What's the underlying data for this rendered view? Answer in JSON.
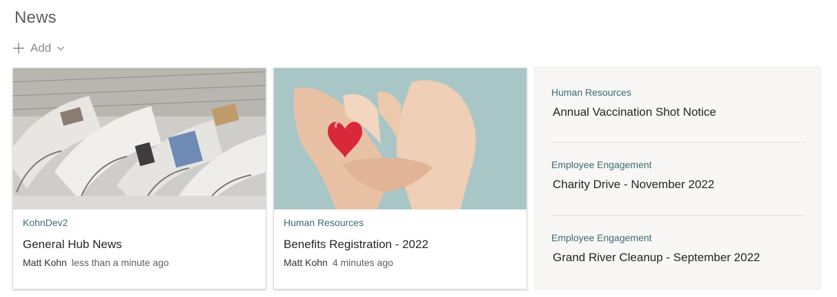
{
  "section": {
    "title": "News"
  },
  "toolbar": {
    "add_label": "Add"
  },
  "cards": [
    {
      "site": "KohnDev2",
      "title": "General Hub News",
      "author": "Matt Kohn",
      "time": "less than a minute ago",
      "image": "newspapers"
    },
    {
      "site": "Human Resources",
      "title": "Benefits Registration - 2022",
      "author": "Matt Kohn",
      "time": "4 minutes ago",
      "image": "hands-holding-heart"
    }
  ],
  "side_list": [
    {
      "site": "Human Resources",
      "title": "Annual Vaccination Shot Notice"
    },
    {
      "site": "Employee Engagement",
      "title": "Charity Drive - November 2022"
    },
    {
      "site": "Employee Engagement",
      "title": "Grand River Cleanup - September 2022"
    }
  ],
  "colors": {
    "site_link": "#3b6b73",
    "panel_bg": "#f8f7f5",
    "heart": "#d8283a",
    "photo_bg": "#a9c6c7"
  }
}
